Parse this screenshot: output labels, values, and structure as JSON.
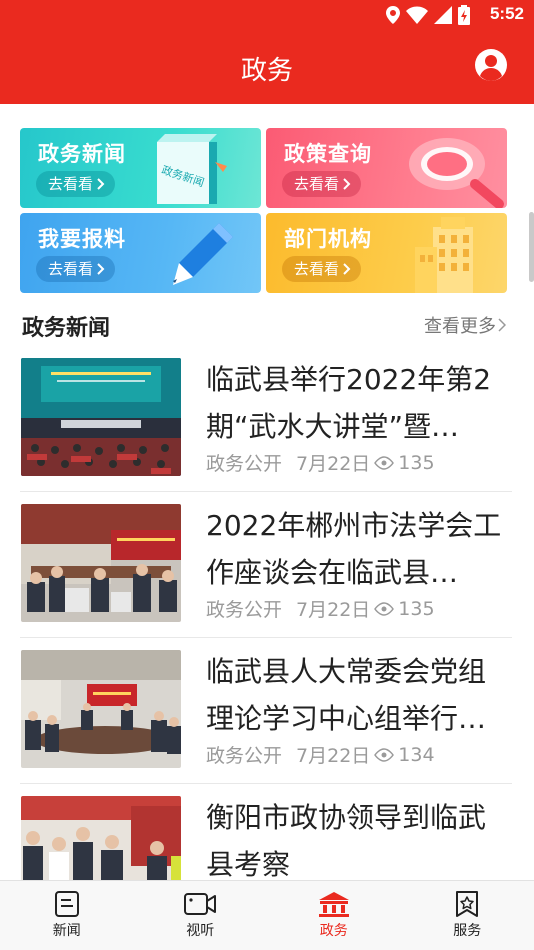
{
  "status_bar": {
    "time": "5:52"
  },
  "header": {
    "title": "政务"
  },
  "tiles": [
    {
      "label": "政务新闻",
      "button": "去看看",
      "art_text": "政务新闻"
    },
    {
      "label": "政策查询",
      "button": "去看看"
    },
    {
      "label": "我要报料",
      "button": "去看看"
    },
    {
      "label": "部门机构",
      "button": "去看看"
    }
  ],
  "section": {
    "title": "政务新闻",
    "more": "查看更多"
  },
  "news": [
    {
      "title": "临武县举行2022年第2期“武水大讲堂”暨…",
      "source": "政务公开",
      "date": "7月22日",
      "views": "135"
    },
    {
      "title": "2022年郴州市法学会工作座谈会在临武县…",
      "source": "政务公开",
      "date": "7月22日",
      "views": "135"
    },
    {
      "title": "临武县人大常委会党组理论学习中心组举行…",
      "source": "政务公开",
      "date": "7月22日",
      "views": "134"
    },
    {
      "title": "衡阳市政协领导到临武县考察",
      "source": "",
      "date": "",
      "views": ""
    }
  ],
  "bottom_nav": [
    {
      "label": "新闻",
      "icon": "news-icon"
    },
    {
      "label": "视听",
      "icon": "video-icon"
    },
    {
      "label": "政务",
      "icon": "government-icon"
    },
    {
      "label": "服务",
      "icon": "service-icon"
    }
  ],
  "colors": {
    "brand_red": "#ea2a1f",
    "meta_gray": "#9a9a9a"
  }
}
